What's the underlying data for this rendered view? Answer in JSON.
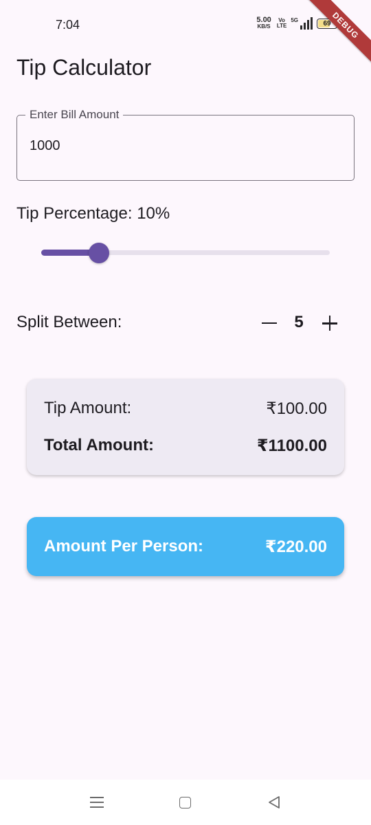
{
  "status_bar": {
    "time": "7:04",
    "net_speed_value": "5.00",
    "net_speed_unit": "KB/S",
    "volte_top": "Vo",
    "volte_bottom": "LTE",
    "network_label": "5G",
    "battery_level": "69",
    "battery_fraction": 0.69,
    "battery_fill_color": "#f3de8a"
  },
  "debug_banner": "DEBUG",
  "app": {
    "title": "Tip Calculator",
    "bill_input": {
      "label": "Enter Bill Amount",
      "value": "1000"
    },
    "tip_percentage_label": "Tip Percentage: 10%",
    "tip_slider": {
      "fraction": 0.2,
      "accent_color": "#6750a4",
      "inactive_color": "#e7e0ec"
    },
    "split": {
      "label": "Split Between:",
      "count": "5",
      "minus_icon": "minus-icon",
      "plus_icon": "plus-icon"
    },
    "summary": {
      "tip_label": "Tip Amount:",
      "tip_value": "₹100.00",
      "total_label": "Total Amount:",
      "total_value": "₹1100.00"
    },
    "per_person": {
      "label": "Amount Per Person:",
      "value": "₹220.00",
      "color": "#46b6f3"
    }
  },
  "nav_bar": {
    "recent_icon": "recent-apps-icon",
    "home_icon": "home-icon",
    "back_icon": "back-icon"
  }
}
